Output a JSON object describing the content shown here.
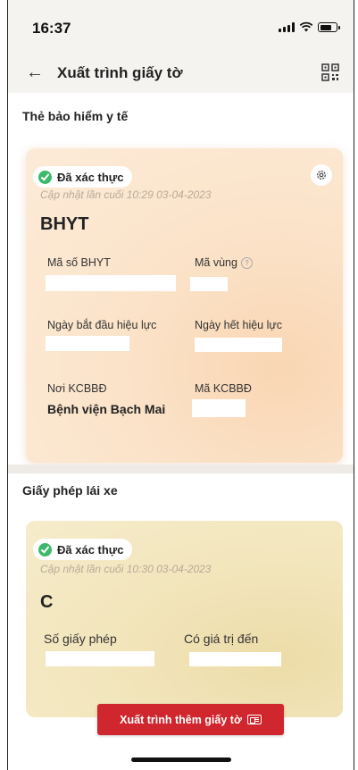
{
  "status": {
    "time": "16:37"
  },
  "header": {
    "title": "Xuất trình giấy tờ",
    "back_icon": "arrow-left-icon",
    "qr_icon": "qr-code-icon"
  },
  "bhyt_section": {
    "title": "Thẻ bảo hiểm y tế",
    "card": {
      "badge": "Đã xác thực",
      "updated": "Cập nhật lần cuối 10:29 03-04-2023",
      "code": "BHYT",
      "labels": {
        "ma_so": "Mã số BHYT",
        "ma_vung": "Mã vùng",
        "ngay_bat_dau": "Ngày bắt đầu hiệu lực",
        "ngay_het": "Ngày hết hiệu lực",
        "noi_kcbbd": "Nơi KCBBĐ",
        "ma_kcbbd": "Mã KCBBĐ"
      },
      "noi_kcbbd_value": "Bệnh viện Bạch Mai"
    }
  },
  "gplx_section": {
    "title": "Giấy phép lái xe",
    "card": {
      "badge": "Đã xác thực",
      "updated": "Cập nhật lần cuối 10:30 03-04-2023",
      "class": "C",
      "labels": {
        "so_giay_phep": "Số giấy phép",
        "co_gia_tri": "Có giá trị đến"
      }
    }
  },
  "cta": {
    "label": "Xuất trình thêm giấy tờ"
  },
  "colors": {
    "cta": "#d0262d",
    "verified": "#3cb96a"
  }
}
